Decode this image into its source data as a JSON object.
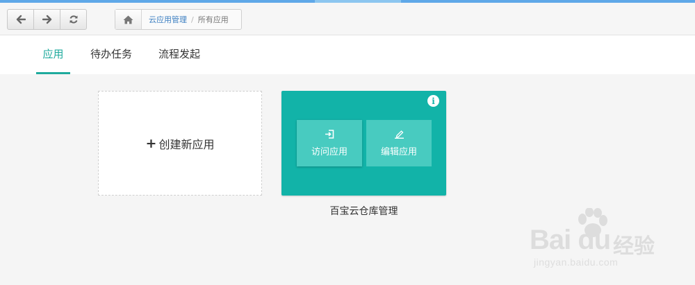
{
  "colors": {
    "accent": "#1eaa9d",
    "card_bg": "#12b3a8",
    "card_button_bg": "#48cbc0",
    "link": "#3c7fc1",
    "top_strip": "#5fa8e8"
  },
  "toolbar": {
    "nav_buttons": [
      {
        "icon": "arrow-left-icon"
      },
      {
        "icon": "arrow-right-icon"
      },
      {
        "icon": "refresh-icon"
      }
    ]
  },
  "breadcrumb": {
    "home_icon": "home-icon",
    "parent": "云应用管理",
    "separator": "/",
    "current": "所有应用"
  },
  "tabs": [
    {
      "label": "应用",
      "active": true
    },
    {
      "label": "待办任务",
      "active": false
    },
    {
      "label": "流程发起",
      "active": false
    }
  ],
  "create_card": {
    "icon": "+",
    "label": "创建新应用"
  },
  "app_card": {
    "info_icon": "i",
    "visit_label": "访问应用",
    "visit_icon": "sign-in-icon",
    "edit_label": "编辑应用",
    "edit_icon": "edit-icon",
    "name": "百宝云仓库管理"
  },
  "watermark": {
    "brand": "Bai  du",
    "cn": "经验",
    "url": "jingyan.baidu.com"
  }
}
